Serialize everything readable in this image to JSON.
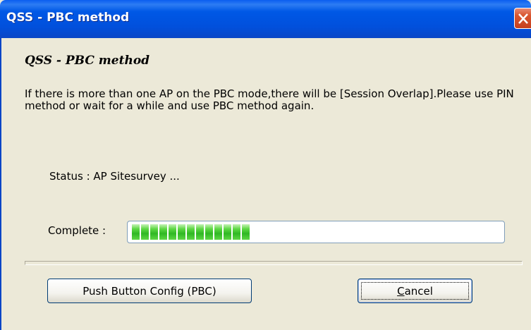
{
  "window": {
    "title": "QSS - PBC method"
  },
  "dialog": {
    "heading": "QSS - PBC method",
    "info_text": "If there is more than one AP on the PBC mode,there will be [Session Overlap].Please use PIN method or wait for a while and use PBC method again.",
    "status_text": "Status : AP Sitesurvey ...",
    "complete_label": "Complete :",
    "progress_fraction": 0.32
  },
  "buttons": {
    "pbc_label": "Push Button Config (PBC)",
    "cancel_label_first": "C",
    "cancel_label_rest": "ancel"
  },
  "icons": {
    "close": "close-icon"
  },
  "colors": {
    "titlebar": "#0058e6",
    "dialog_bg": "#ece9d8",
    "progress_green": "#2fb824",
    "close_red": "#d9562f"
  }
}
